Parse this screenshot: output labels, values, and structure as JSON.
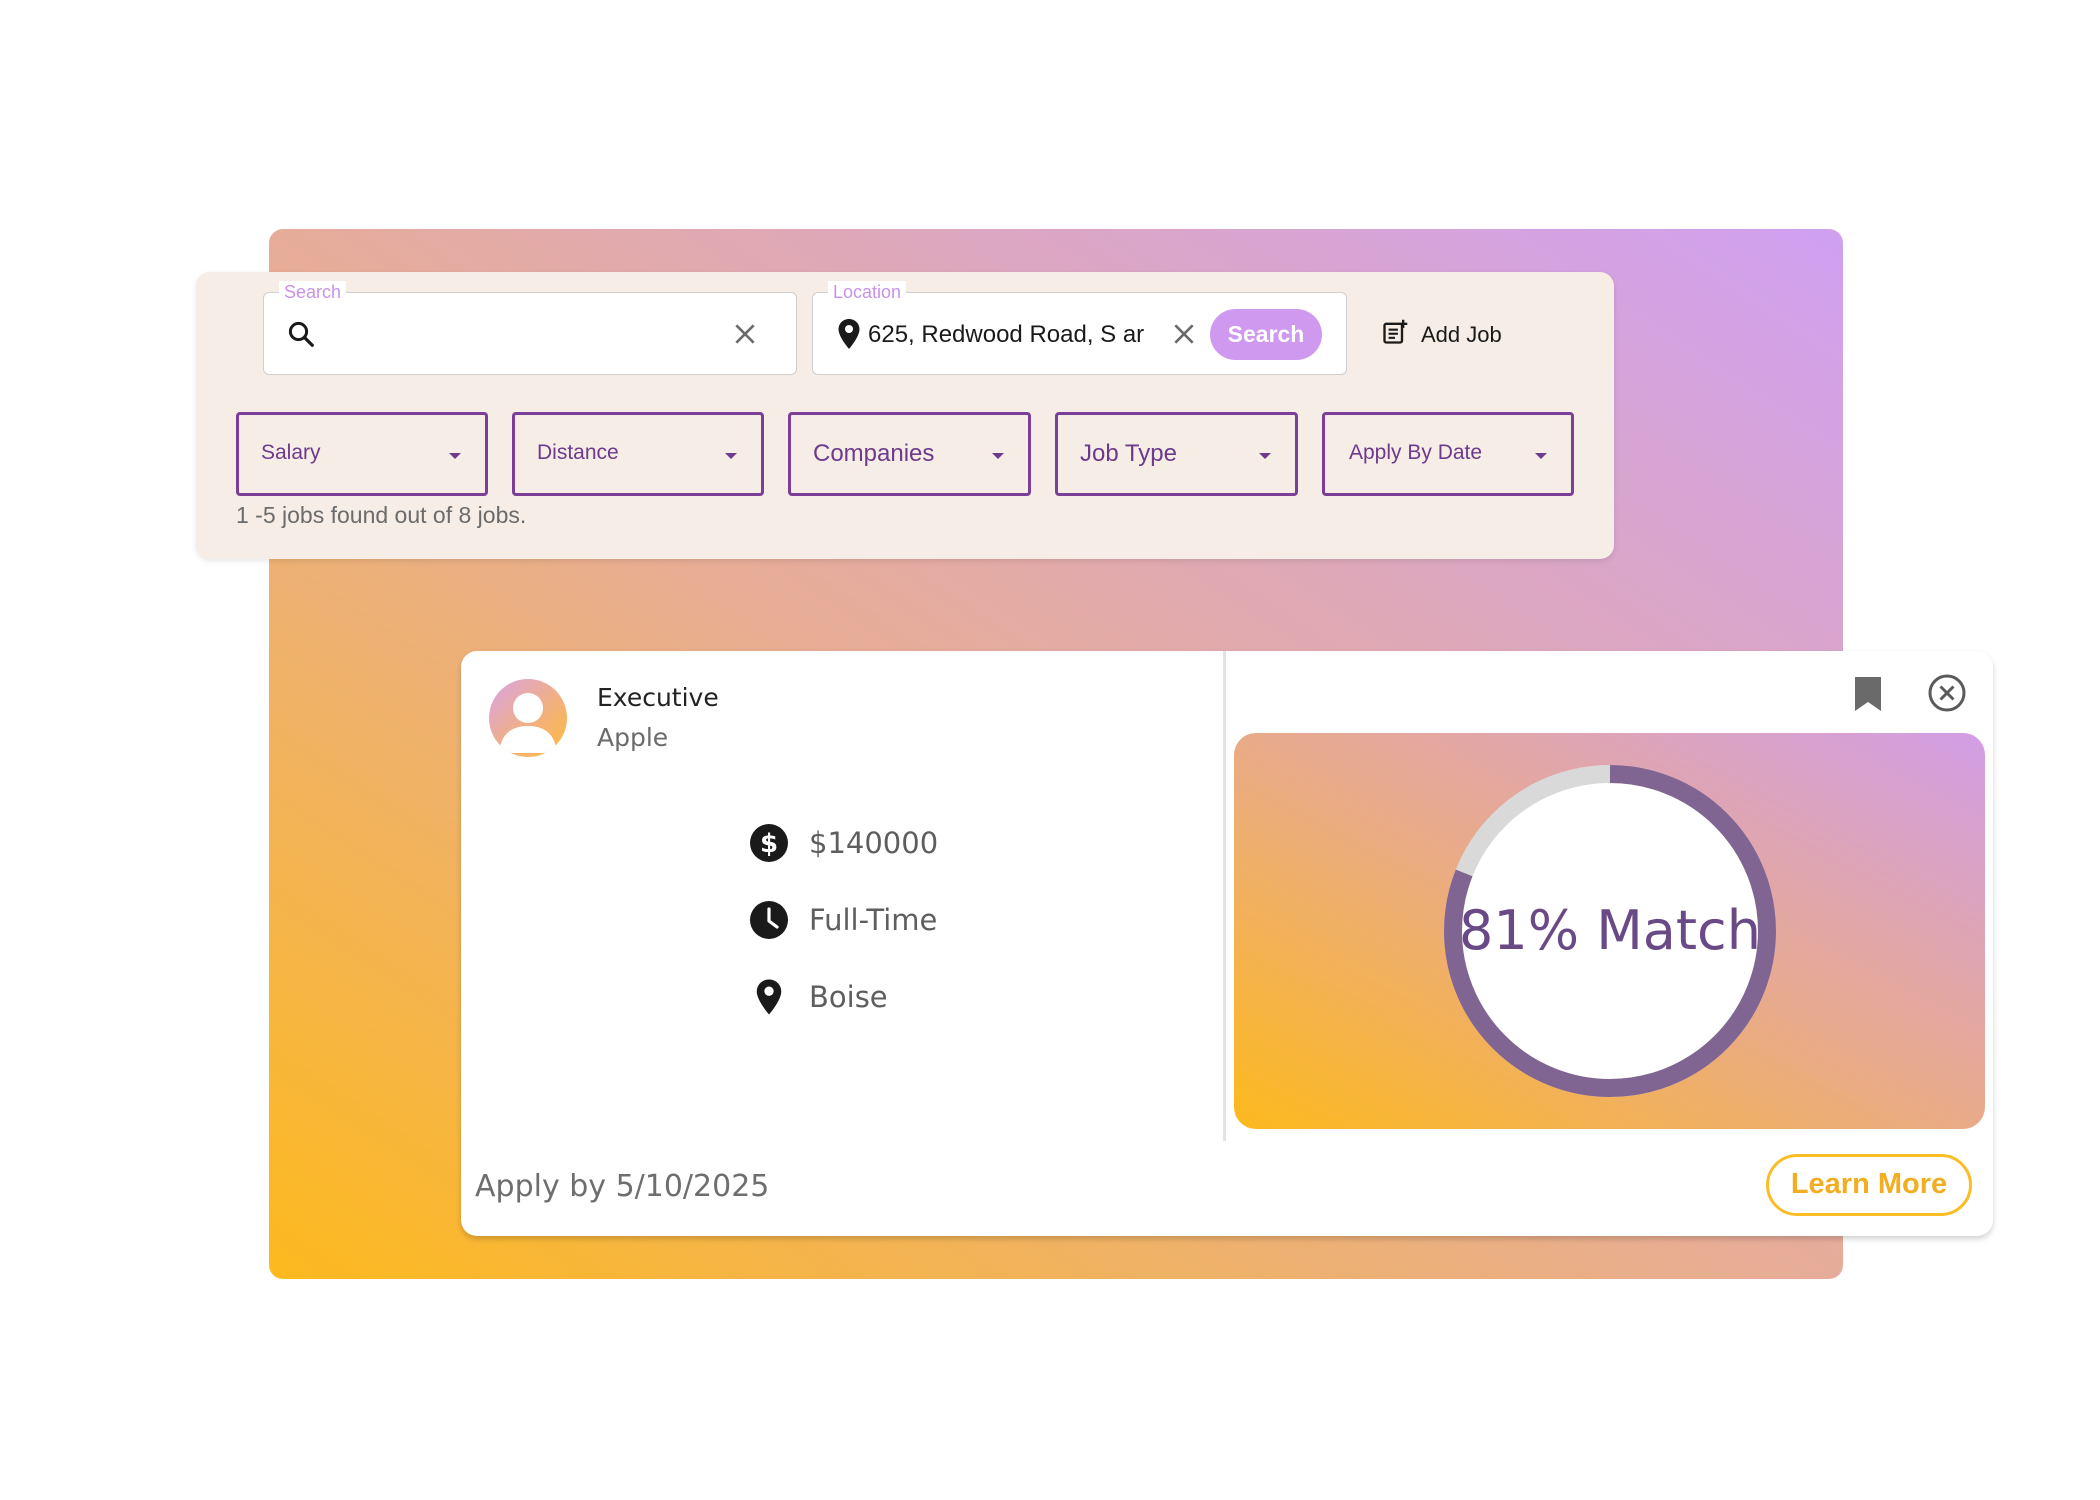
{
  "search": {
    "legend": "Search",
    "value": "",
    "icon": "search-icon",
    "clear_icon": "close-icon"
  },
  "location": {
    "legend": "Location",
    "value": "625, Redwood Road, S ar",
    "icon": "location-pin-icon",
    "clear_icon": "close-icon"
  },
  "search_button": {
    "label": "Search"
  },
  "add_job": {
    "label": "Add Job",
    "icon": "add-note-icon"
  },
  "filters": [
    {
      "label": "Salary"
    },
    {
      "label": "Distance"
    },
    {
      "label": "Companies"
    },
    {
      "label": "Job Type"
    },
    {
      "label": "Apply By Date"
    }
  ],
  "results": {
    "text": "1 -5 jobs found out of 8 jobs."
  },
  "job_card": {
    "title": "Executive",
    "company": "Apple",
    "details": [
      {
        "icon": "dollar-icon",
        "text": "$140000"
      },
      {
        "icon": "clock-icon",
        "text": "Full-Time"
      },
      {
        "icon": "location-pin-icon",
        "text": "Boise"
      }
    ],
    "apply_by": "Apply by 5/10/2025",
    "match": {
      "percent": 81,
      "label": "81% Match"
    },
    "learn_more_label": "Learn More",
    "bookmark_icon": "bookmark-icon",
    "close_icon": "close-circle-icon"
  },
  "colors": {
    "accent_purple": "#7b3f98",
    "search_button": "#cf99ef",
    "gauge_filled": "#806491",
    "gauge_remaining": "#d9d9d9",
    "learn_more": "#fbbd26",
    "panel_bg": "#f5ede6"
  }
}
